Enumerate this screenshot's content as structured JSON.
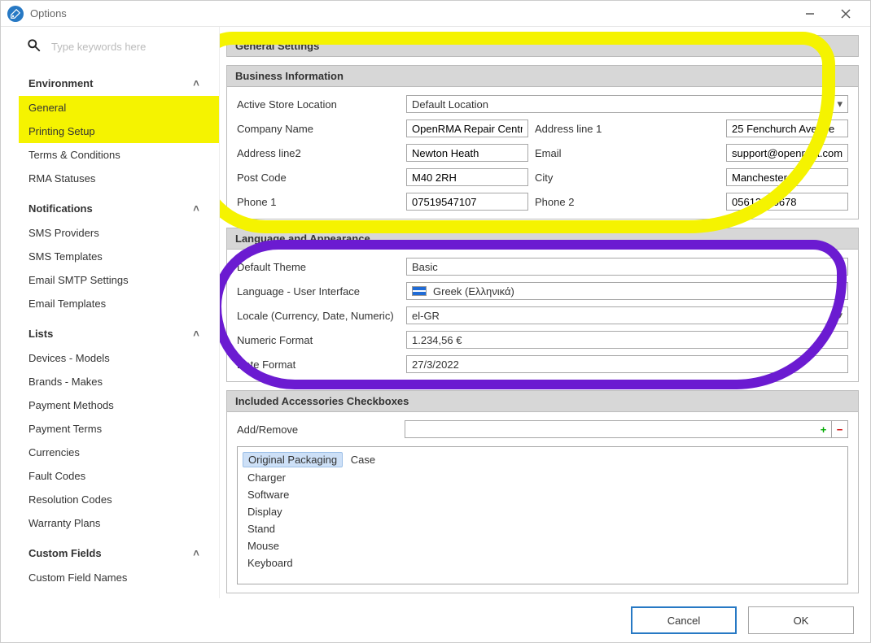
{
  "window": {
    "title": "Options"
  },
  "search": {
    "placeholder": "Type keywords here"
  },
  "sidebar": {
    "sections": [
      {
        "title": "Environment",
        "items": [
          {
            "label": "General",
            "highlight": true
          },
          {
            "label": "Printing Setup",
            "highlight": true
          },
          {
            "label": "Terms & Conditions",
            "highlight": false
          },
          {
            "label": "RMA Statuses",
            "highlight": false
          }
        ]
      },
      {
        "title": "Notifications",
        "items": [
          {
            "label": "SMS Providers"
          },
          {
            "label": "SMS Templates"
          },
          {
            "label": "Email SMTP Settings"
          },
          {
            "label": "Email Templates"
          }
        ]
      },
      {
        "title": "Lists",
        "items": [
          {
            "label": "Devices - Models"
          },
          {
            "label": "Brands - Makes"
          },
          {
            "label": "Payment Methods"
          },
          {
            "label": "Payment Terms"
          },
          {
            "label": "Currencies"
          },
          {
            "label": "Fault Codes"
          },
          {
            "label": "Resolution Codes"
          },
          {
            "label": "Warranty Plans"
          }
        ]
      },
      {
        "title": "Custom Fields",
        "items": [
          {
            "label": "Custom Field Names"
          }
        ]
      }
    ]
  },
  "main": {
    "title": "General Settings",
    "business": {
      "heading": "Business Information",
      "labels": {
        "active_store": "Active Store Location",
        "company": "Company Name",
        "addr1": "Address line 1",
        "addr2": "Address line2",
        "email": "Email",
        "postcode": "Post Code",
        "city": "City",
        "phone1": "Phone 1",
        "phone2": "Phone 2"
      },
      "values": {
        "active_store": "Default Location",
        "company": "OpenRMA Repair Centre",
        "addr1": "25 Fenchurch Avenue",
        "addr2": "Newton Heath",
        "email": "support@openrma.com",
        "postcode": "M40 2RH",
        "city": "Manchester",
        "phone1": "07519547107",
        "phone2": "05612345678"
      }
    },
    "language": {
      "heading": "Language and Appearance",
      "labels": {
        "theme": "Default Theme",
        "ui_lang": "Language - User Interface",
        "locale": "Locale (Currency, Date, Numeric)",
        "numfmt": "Numeric Format",
        "datefmt": "Date Format"
      },
      "values": {
        "theme": "Basic",
        "ui_lang": "Greek (Ελληνικά)",
        "locale": "el-GR",
        "numfmt": "1.234,56 €",
        "datefmt": "27/3/2022"
      }
    },
    "accessories": {
      "heading": "Included Accessories Checkboxes",
      "add_label": "Add/Remove",
      "input_value": "",
      "items": [
        {
          "label": "Original Packaging",
          "selected": true
        },
        {
          "label": "Case",
          "selected": false,
          "sameline": true
        },
        {
          "label": "Charger"
        },
        {
          "label": "Software"
        },
        {
          "label": "Display"
        },
        {
          "label": "Stand"
        },
        {
          "label": "Mouse"
        },
        {
          "label": "Keyboard"
        }
      ]
    }
  },
  "footer": {
    "cancel": "Cancel",
    "ok": "OK"
  },
  "icons": {
    "plus": "+",
    "minus": "−",
    "dropdown": "▾",
    "chevron_up": "˄"
  }
}
